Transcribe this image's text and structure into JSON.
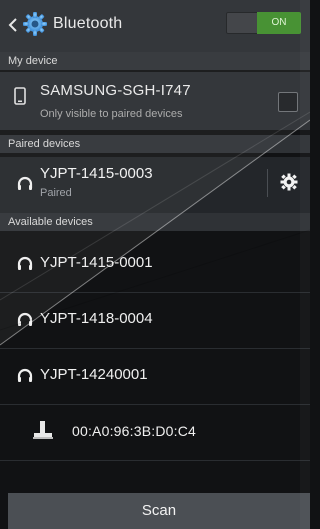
{
  "header": {
    "title": "Bluetooth",
    "toggle": {
      "label": "ON",
      "state": "on",
      "color": "#3f8d2a"
    },
    "back_icon": "back-chevron-icon",
    "app_icon": "bluetooth-settings-gear-icon"
  },
  "sections": {
    "my_device": "My device",
    "paired": "Paired devices",
    "available": "Available devices"
  },
  "my_device": {
    "name": "SAMSUNG-SGH-I747",
    "subtitle": "Only visible to paired devices",
    "visible_checked": false
  },
  "paired_devices": [
    {
      "name": "YJPT-1415-0003",
      "status": "Paired"
    }
  ],
  "available_devices": [
    {
      "name": "YJPT-1415-0001",
      "icon": "headphones-icon"
    },
    {
      "name": "YJPT-1418-0004",
      "icon": "headphones-icon"
    },
    {
      "name": "YJPT-14240001",
      "icon": "headphones-icon"
    },
    {
      "name": "00:A0:96:3B:D0:C4",
      "icon": "computer-icon"
    }
  ],
  "scan_label": "Scan",
  "colors": {
    "accent_on": "#3f8d2a",
    "header_bg": "#2a2d31",
    "section_bg": "#2f3236"
  }
}
